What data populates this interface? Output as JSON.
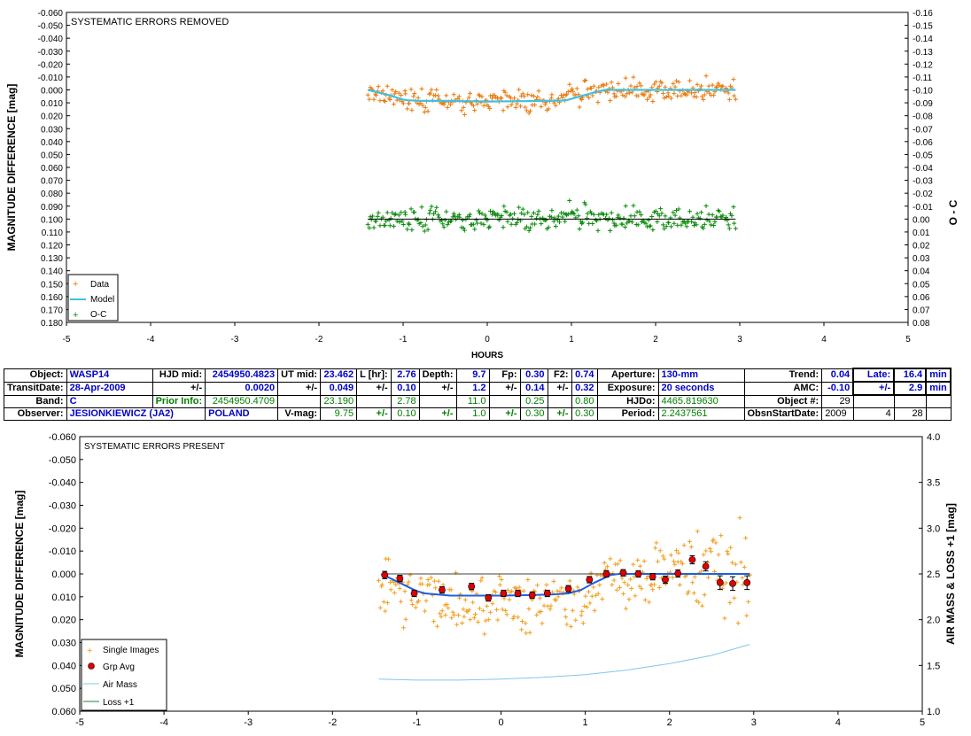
{
  "top_chart": {
    "corner_title": "SYSTEMATIC ERRORS REMOVED",
    "ylabel": "MAGNITUDE DIFFERENCE [mag]",
    "y2label": "O - C",
    "xlabel": "HOURS",
    "xticks": [
      "-5",
      "-4",
      "-3",
      "-2",
      "-1",
      "0",
      "1",
      "2",
      "3",
      "4",
      "5"
    ],
    "yticks": [
      "-0.060",
      "-0.050",
      "-0.040",
      "-0.030",
      "-0.020",
      "-0.010",
      "0.000",
      "0.010",
      "0.020",
      "0.030",
      "0.040",
      "0.050",
      "0.060",
      "0.070",
      "0.080",
      "0.090",
      "0.100",
      "0.110",
      "0.120",
      "0.130",
      "0.140",
      "0.150",
      "0.160",
      "0.170",
      "0.180"
    ],
    "y2ticks": [
      "-0.16",
      "-0.15",
      "-0.14",
      "-0.13",
      "-0.12",
      "-0.11",
      "-0.10",
      "-0.09",
      "-0.08",
      "-0.07",
      "-0.06",
      "-0.05",
      "-0.04",
      "-0.03",
      "-0.02",
      "-0.01",
      "0.00",
      "0.01",
      "0.02",
      "0.03",
      "0.04",
      "0.05",
      "0.06",
      "0.07",
      "0.08"
    ],
    "legend": [
      "Data",
      "Model",
      "O-C"
    ],
    "colors": {
      "data": "#e87a10",
      "model": "#40c0e0",
      "oc": "#0a8a0a",
      "oc_line": "#000000"
    }
  },
  "bottom_chart": {
    "corner_title": "SYSTEMATIC ERRORS PRESENT",
    "ylabel": "MAGNITUDE DIFFERENCE [mag]",
    "y2label": "AIR MASS & LOSS +1 [mag]",
    "xticks": [
      "-5",
      "-4",
      "-3",
      "-2",
      "-1",
      "0",
      "1",
      "2",
      "3",
      "4",
      "5"
    ],
    "yticks": [
      "-0.060",
      "-0.050",
      "-0.040",
      "-0.030",
      "-0.020",
      "-0.010",
      "0.000",
      "0.010",
      "0.020",
      "0.030",
      "0.040",
      "0.050",
      "0.060"
    ],
    "y2ticks": [
      "4.0",
      "3.5",
      "3.0",
      "2.5",
      "2.0",
      "1.5",
      "1.0"
    ],
    "legend": [
      "Single Images",
      "Grp Avg",
      "Air Mass",
      "Loss +1"
    ],
    "colors": {
      "single": "#f0a020",
      "grp": "#e00000",
      "model": "#2060e0",
      "airmass": "#80c8e8",
      "loss": "#208040"
    }
  },
  "table": {
    "r1": [
      "Object:",
      "WASP14",
      "HJD mid:",
      "2454950.4823",
      "UT mid:",
      "23.462",
      "L [hr]:",
      "2.76",
      "Depth:",
      "9.7",
      "Fp:",
      "0.30",
      "F2:",
      "0.74",
      "Aperture:",
      "130-mm",
      "Trend:",
      "0.04",
      "Late:",
      "16.4",
      "min"
    ],
    "r2": [
      "TransitDate:",
      "28-Apr-2009",
      "+/-",
      "0.0020",
      "+/-",
      "0.049",
      "+/-",
      "0.10",
      "+/-",
      "1.2",
      "+/-",
      "0.14",
      "+/-",
      "0.32",
      "Exposure:",
      "20 seconds",
      "AMC:",
      "-0.10",
      "+/-",
      "2.9",
      "min"
    ],
    "r3": [
      "Band:",
      "C",
      "Prior Info:",
      "2454950.4709",
      "",
      "23.190",
      "",
      "2.78",
      "",
      "11.0",
      "",
      "0.25",
      "",
      "0.80",
      "HJDo:",
      "4465.819630",
      "Object #:",
      "29",
      "",
      "",
      ""
    ],
    "r4": [
      "Observer:",
      "JESIONKIEWICZ (JA2)",
      "POLAND",
      "",
      "V-mag:",
      "9.75",
      "+/-",
      "0.10",
      "+/-",
      "1.0",
      "+/-",
      "0.30",
      "+/-",
      "0.30",
      "Period:",
      "2.2437561",
      "ObsnStartDate:",
      "2009",
      "4",
      "28",
      ""
    ]
  },
  "chart_data": [
    {
      "type": "scatter",
      "title": "SYSTEMATIC ERRORS REMOVED",
      "xlabel": "HOURS",
      "ylabel": "MAGNITUDE DIFFERENCE [mag]",
      "y2label": "O - C",
      "xlim": [
        -5,
        5
      ],
      "ylim": [
        -0.06,
        0.18
      ],
      "y2lim": [
        -0.16,
        0.08
      ],
      "y_inverted": true,
      "legend_position": "bottom-left",
      "series": [
        {
          "name": "Data",
          "marker": "+",
          "x_range": [
            -1.42,
            2.95
          ],
          "y_center": 0.004,
          "scatter": 0.006
        },
        {
          "name": "Model",
          "line": true,
          "x": [
            -1.42,
            -1.2,
            -1.0,
            -0.95,
            -0.8,
            -0.5,
            -0.2,
            0.0,
            0.3,
            0.6,
            0.9,
            0.95,
            1.1,
            1.3,
            1.4,
            1.6,
            2.0,
            2.5,
            2.95
          ],
          "y": [
            0.0,
            0.0035,
            0.0075,
            0.008,
            0.0085,
            0.0085,
            0.0088,
            0.009,
            0.0088,
            0.0086,
            0.0082,
            0.0078,
            0.005,
            0.0015,
            0.0,
            0.0,
            0.0,
            0.0,
            0.0
          ]
        },
        {
          "name": "O-C",
          "marker": "+",
          "x_range": [
            -1.42,
            2.95
          ],
          "y_center": 0.1,
          "scatter": 0.006
        }
      ]
    },
    {
      "type": "scatter",
      "title": "SYSTEMATIC ERRORS PRESENT",
      "ylabel": "MAGNITUDE DIFFERENCE [mag]",
      "y2label": "AIR MASS & LOSS +1 [mag]",
      "xlim": [
        -5,
        5
      ],
      "ylim": [
        -0.06,
        0.06
      ],
      "y2lim": [
        1.0,
        4.0
      ],
      "y_inverted": true,
      "legend_position": "bottom-left",
      "series": [
        {
          "name": "Single Images",
          "marker": "+",
          "x_range": [
            -1.45,
            2.95
          ],
          "y_center": 0.005,
          "scatter": 0.008
        },
        {
          "name": "Grp Avg",
          "x": [
            -1.38,
            -1.2,
            -1.03,
            -0.7,
            -0.35,
            -0.15,
            0.03,
            0.2,
            0.37,
            0.55,
            0.8,
            1.05,
            1.25,
            1.45,
            1.63,
            1.8,
            1.95,
            2.1,
            2.27,
            2.43,
            2.6,
            2.75,
            2.92
          ],
          "y": [
            0.0005,
            0.002,
            0.0085,
            0.007,
            0.0055,
            0.0105,
            0.0085,
            0.0085,
            0.0093,
            0.0085,
            0.0065,
            0.0025,
            0.0,
            -0.0005,
            0.0,
            0.0012,
            0.0025,
            -0.0002,
            -0.0062,
            -0.0033,
            0.0038,
            0.0042,
            0.0038
          ],
          "err": [
            0.0016,
            0.0014,
            0.0014,
            0.0014,
            0.0014,
            0.0014,
            0.0014,
            0.0014,
            0.0014,
            0.0014,
            0.0014,
            0.0014,
            0.0014,
            0.0014,
            0.0014,
            0.0014,
            0.0016,
            0.0016,
            0.0018,
            0.002,
            0.003,
            0.003,
            0.003
          ]
        },
        {
          "name": "Model",
          "line": true,
          "x": [
            -1.42,
            -1.25,
            -1.0,
            -0.9,
            -0.6,
            -0.3,
            0.0,
            0.3,
            0.6,
            0.8,
            0.95,
            1.1,
            1.3,
            1.4,
            1.6,
            2.0,
            2.5,
            2.95
          ],
          "y": [
            0.0,
            0.003,
            0.0075,
            0.0085,
            0.0095,
            0.0095,
            0.0095,
            0.0093,
            0.009,
            0.0085,
            0.007,
            0.004,
            0.0005,
            0.0,
            0.0,
            0.0,
            0.0,
            0.0
          ]
        },
        {
          "name": "Air Mass",
          "axis": "y2",
          "line": true,
          "x": [
            -1.45,
            -1.0,
            -0.5,
            0.0,
            0.5,
            1.0,
            1.5,
            2.0,
            2.5,
            2.95
          ],
          "y": [
            1.35,
            1.34,
            1.34,
            1.35,
            1.37,
            1.4,
            1.45,
            1.52,
            1.61,
            1.73
          ]
        },
        {
          "name": "Loss +1",
          "axis": "y2",
          "line": true,
          "x": [],
          "y": []
        }
      ]
    }
  ]
}
